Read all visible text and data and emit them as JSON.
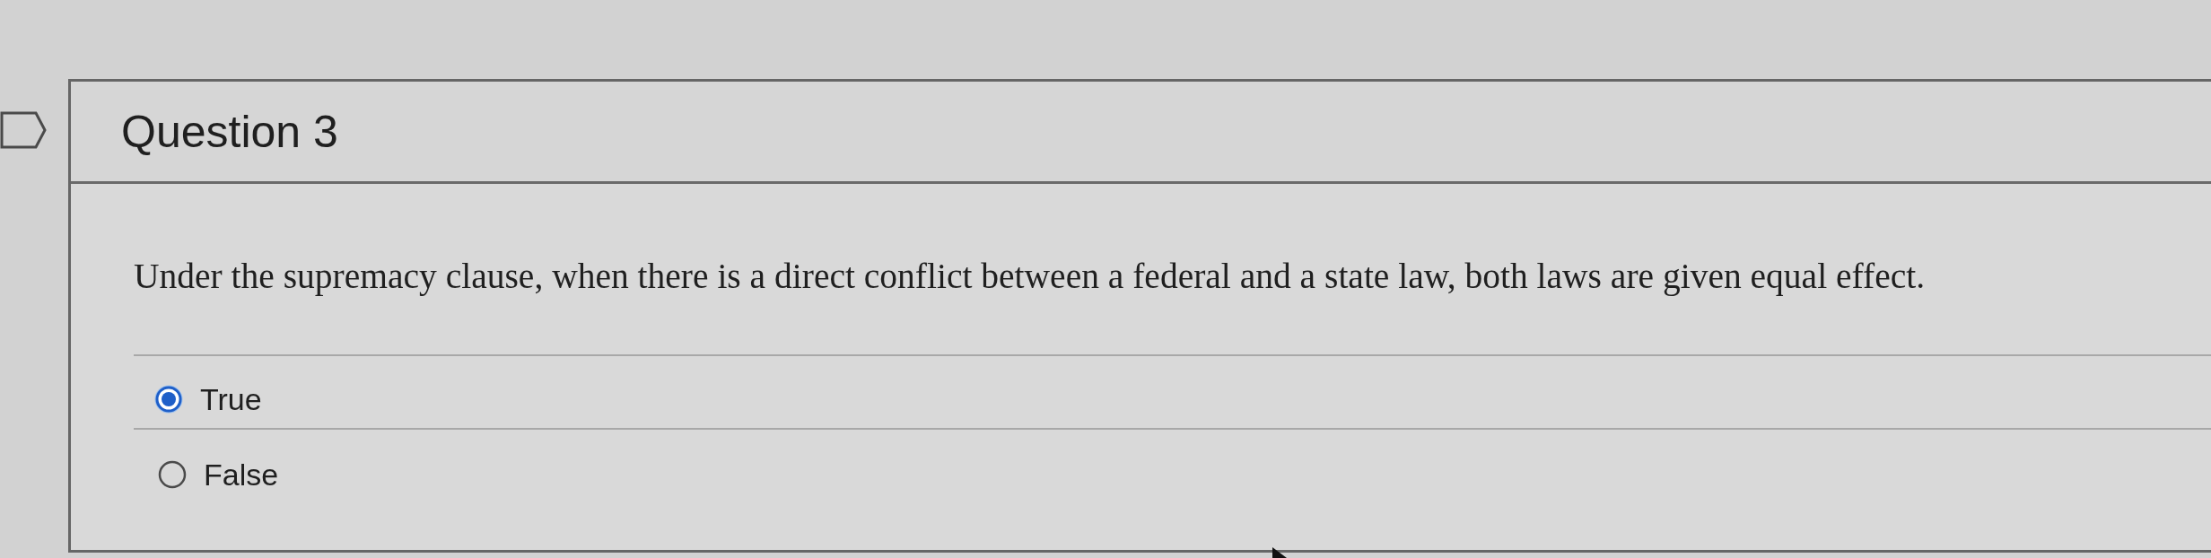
{
  "question": {
    "title": "Question 3",
    "prompt": "Under the supremacy clause, when there is a direct conflict between a federal and a state law, both laws are given equal effect."
  },
  "options": [
    {
      "label": "True",
      "selected": true
    },
    {
      "label": "False",
      "selected": false
    }
  ]
}
